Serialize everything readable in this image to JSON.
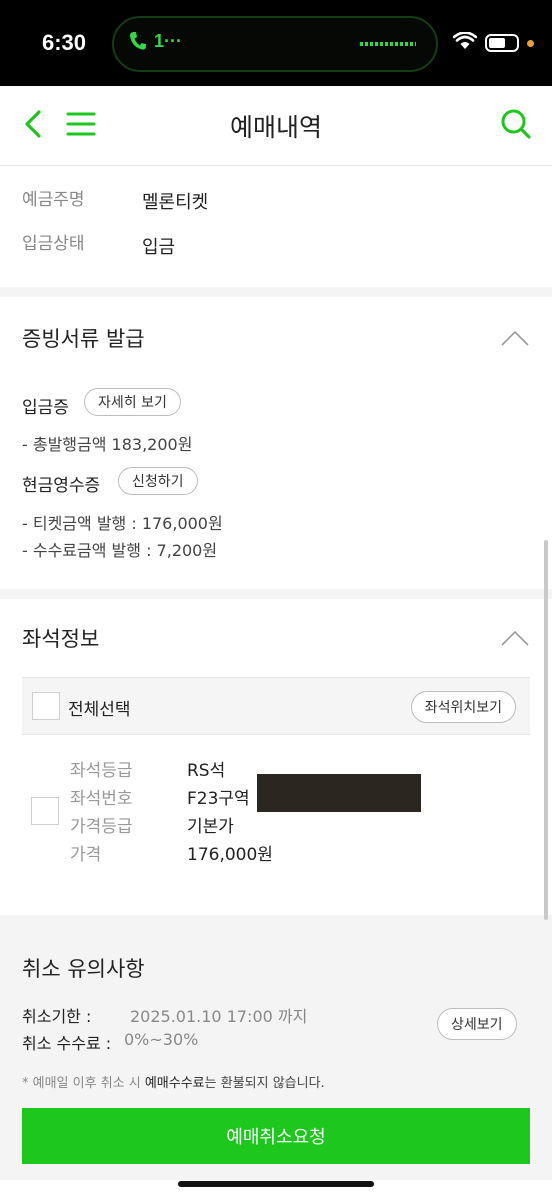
{
  "status_bar": {
    "time": "6:30",
    "call_label": "1···"
  },
  "header": {
    "title": "예매내역",
    "back_icon": "chevron-left-icon",
    "menu_icon": "hamburger-menu-icon",
    "search_icon": "search-icon",
    "accent_color": "#1ec71e"
  },
  "deposit": {
    "rows": [
      {
        "label": "예금주명",
        "value": "멜론티켓"
      },
      {
        "label": "입금상태",
        "value": "입금"
      }
    ]
  },
  "receipts": {
    "title": "증빙서류 발급",
    "deposit_cert_label": "입금증",
    "deposit_cert_button": "자세히 보기",
    "total_line": "- 총발행금액 183,200원",
    "cash_receipt_label": "현금영수증",
    "cash_receipt_button": "신청하기",
    "ticket_line": "- 티켓금액 발행 : 176,000원",
    "fee_line": "- 수수료금액 발행 : 7,200원"
  },
  "seat_info": {
    "title": "좌석정보",
    "select_all_label": "전체선택",
    "seat_location_button": "좌석위치보기",
    "seat": {
      "grade_label": "좌석등급",
      "grade_value": "RS석",
      "number_label": "좌석번호",
      "number_value": "F23구역",
      "price_grade_label": "가격등급",
      "price_grade_value": "기본가",
      "price_label": "가격",
      "price_value": "176,000원"
    }
  },
  "cancel_notice": {
    "title": "취소 유의사항",
    "deadline_label": "취소기한 :",
    "deadline_value": "2025.01.10 17:00 까지",
    "fee_label": "취소 수수료 :",
    "fee_value": "0%~30%",
    "detail_button": "상세보기",
    "note_prefix": "* 예매일 이후 취소 시 ",
    "note_bold": "예매수수료",
    "note_suffix": "는 환불되지 않습니다."
  },
  "cancel_button": {
    "label": "예매취소요청",
    "color": "#1ec71e"
  }
}
